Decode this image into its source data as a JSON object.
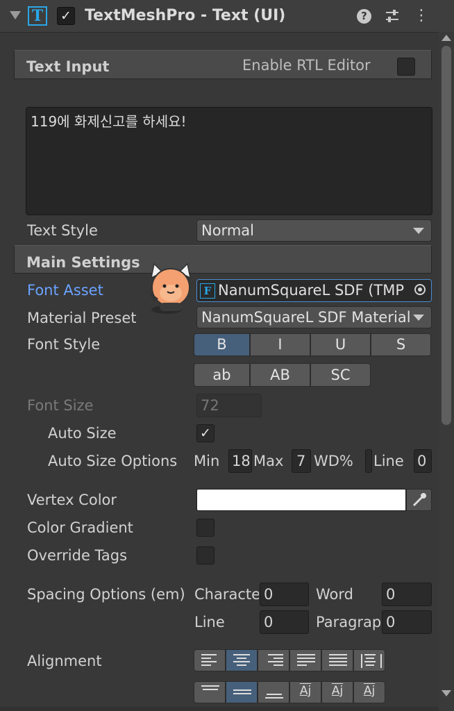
{
  "header": {
    "title": "TextMeshPro - Text (UI)",
    "tmp_icon_glyph": "T",
    "enabled": true,
    "check_glyph": "✓",
    "help_glyph": "?",
    "kebab_glyph": "⋮"
  },
  "text_input": {
    "section_title": "Text Input",
    "rtl_label": "Enable RTL Editor",
    "rtl_enabled": false,
    "value": "119에 화제신고를 하세요!"
  },
  "text_style": {
    "label": "Text Style",
    "value": "Normal"
  },
  "main_settings": {
    "section_title": "Main Settings",
    "font_asset": {
      "label": "Font Asset",
      "value": "NanumSquareL SDF (TMP",
      "icon_glyph": "F"
    },
    "material_preset": {
      "label": "Material Preset",
      "value": "NanumSquareL SDF Material"
    },
    "font_style": {
      "label": "Font Style",
      "row1": [
        "B",
        "I",
        "U",
        "S"
      ],
      "row2": [
        "ab",
        "AB",
        "SC"
      ],
      "active": "B"
    },
    "font_size": {
      "label": "Font Size",
      "value": "72"
    },
    "auto_size": {
      "label": "Auto Size",
      "checked": true
    },
    "auto_size_options": {
      "label": "Auto Size Options",
      "min_label": "Min",
      "min_value": "18",
      "max_label": "Max",
      "max_value": "7",
      "wd_label": "WD%",
      "wd_value": "",
      "line_label": "Line",
      "line_value": "0"
    },
    "vertex_color": {
      "label": "Vertex Color",
      "color": "#ffffff"
    },
    "color_gradient": {
      "label": "Color Gradient",
      "checked": false
    },
    "override_tags": {
      "label": "Override Tags",
      "checked": false
    },
    "spacing": {
      "label": "Spacing Options (em)",
      "character_label": "Characte",
      "character_value": "0",
      "word_label": "Word",
      "word_value": "0",
      "line_label": "Line",
      "line_value": "0",
      "paragraph_label": "Paragraр",
      "paragraph_value": "0"
    },
    "alignment": {
      "label": "Alignment",
      "horizontal": [
        "align-left-icon",
        "align-center-icon",
        "align-right-icon",
        "justify-icon",
        "flush-icon",
        "geometry-center-icon"
      ],
      "horizontal_active": 1,
      "vertical": [
        "align-top-icon",
        "align-middle-icon",
        "align-bottom-icon",
        "baseline-icon",
        "midline-icon",
        "capline-icon"
      ],
      "vertical_active": 1,
      "vertical_glyph": "Aj"
    }
  },
  "colors": {
    "accent": "#46607c",
    "link_label": "#6aa3ff",
    "tmp_blue": "#2aa7e8"
  }
}
